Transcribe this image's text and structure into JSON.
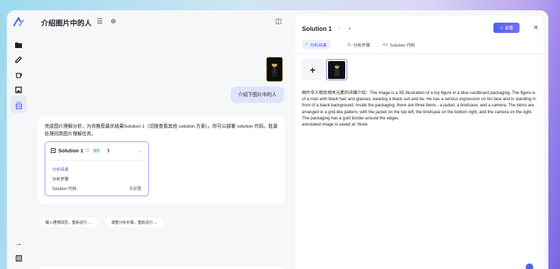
{
  "colors": {
    "accent": "#4c5fe6",
    "deploy_gradient": [
      "#4a64f0",
      "#7b6ef2"
    ],
    "user_bubble": "#dfe3fb"
  },
  "sidebar": {
    "items": [
      {
        "icon": "folder-icon"
      },
      {
        "icon": "edit-icon"
      },
      {
        "icon": "teapot-icon"
      },
      {
        "icon": "image-icon"
      },
      {
        "icon": "dataset-icon",
        "badge": "beta"
      }
    ],
    "bottom": [
      {
        "icon": "arrow-right-icon"
      },
      {
        "icon": "library-icon"
      }
    ]
  },
  "main": {
    "title": "介绍图片中的人",
    "user_message": "介绍下图片中的人",
    "assistant": {
      "text": "完成图片理解分析，为你推荐最优结果Solution 1（切换查看其他 solution 方案）。你可以部署 solution 代码，批量处理同类图片理解任务。",
      "solution": {
        "title": "Solution 1",
        "fraction": "/2",
        "tag": "推荐",
        "items": [
          "分析结果",
          "分析步骤",
          "Solution 代码"
        ],
        "deploy_label": "去部署"
      }
    },
    "chips": [
      "输入理想回答，重新运行 →",
      "调整分析步骤，重新运行 →"
    ]
  },
  "panel": {
    "title": "Solution 1",
    "deploy_label": "部署",
    "tabs": [
      "分析结果",
      "分析步骤",
      "Solution 代码"
    ],
    "result_text": "图片中人物及相关元素的详细介绍：The image is a 3D illustration of a toy figure in a blue cardboard packaging. The figure is of a man with black hair and glasses, wearing a black suit and tie. He has a serious expression on his face and is standing in front of a black background. Inside the packaging, there are three items - a jacket, a briefcase, and a camera. The items are arranged in a grid-like pattern, with the jacket on the top left, the briefcase on the bottom right, and the camera on the right. The packaging has a gold border around the edges.",
    "saved_text": "annotated image is saved at: None"
  }
}
